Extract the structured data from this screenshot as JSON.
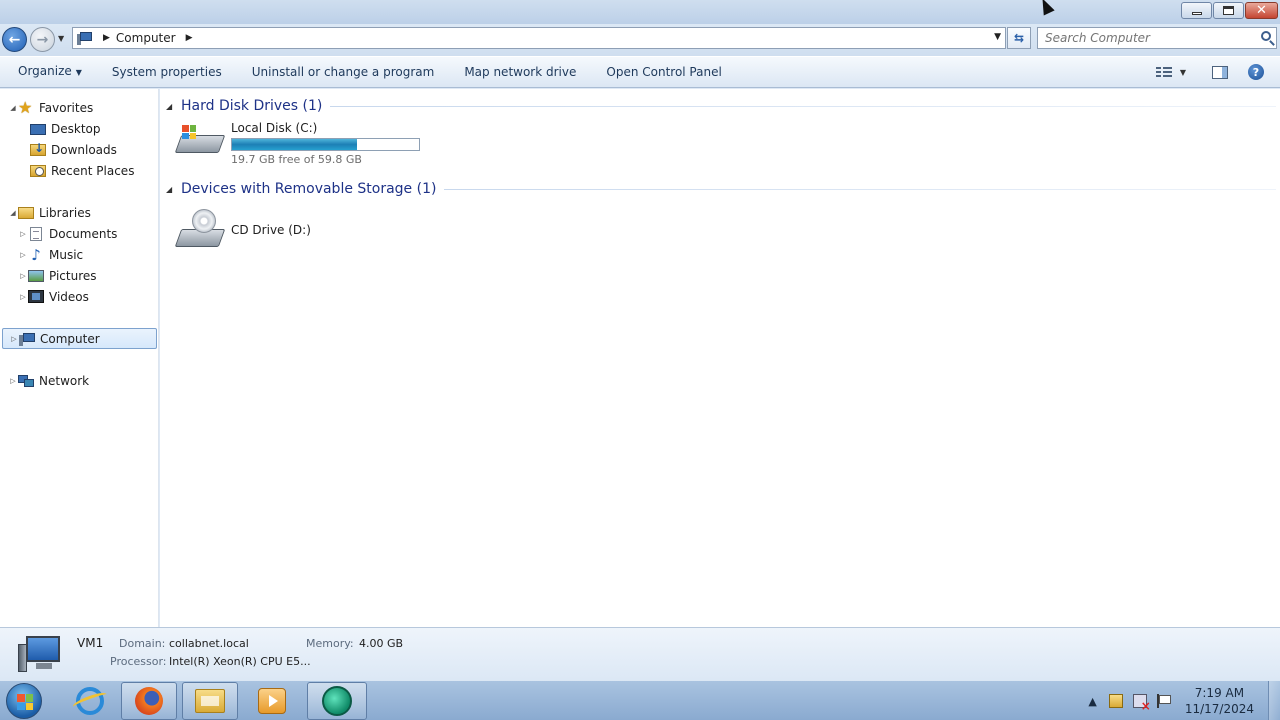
{
  "window": {
    "controls": {
      "minimize": "minimize",
      "maximize": "restore",
      "close": "close"
    }
  },
  "address": {
    "breadcrumb": "Computer",
    "search_placeholder": "Search Computer"
  },
  "commandbar": {
    "organize": "Organize",
    "system_properties": "System properties",
    "uninstall": "Uninstall or change a program",
    "map_drive": "Map network drive",
    "control_panel": "Open Control Panel"
  },
  "navpane": {
    "favorites": "Favorites",
    "desktop": "Desktop",
    "downloads": "Downloads",
    "recent_places": "Recent Places",
    "libraries": "Libraries",
    "documents": "Documents",
    "music": "Music",
    "pictures": "Pictures",
    "videos": "Videos",
    "computer": "Computer",
    "network": "Network"
  },
  "content": {
    "hdd_group": "Hard Disk Drives (1)",
    "removable_group": "Devices with Removable Storage (1)",
    "local_disk": {
      "name": "Local Disk (C:)",
      "free_text": "19.7 GB free of 59.8 GB",
      "used_fraction": 0.67
    },
    "cd_drive": {
      "name": "CD Drive (D:)"
    }
  },
  "details": {
    "name": "VM1",
    "domain_label": "Domain:",
    "domain_value": "collabnet.local",
    "memory_label": "Memory:",
    "memory_value": "4.00 GB",
    "processor_label": "Processor:",
    "processor_value": "Intel(R) Xeon(R) CPU E5..."
  },
  "taskbar": {
    "time": "7:19 AM",
    "date": "11/17/2024",
    "tray_expand": "▲"
  },
  "colors": {
    "group_title": "#1e3287",
    "usage_bar": "#1d7fb5",
    "selection": "#d6e8fb"
  }
}
